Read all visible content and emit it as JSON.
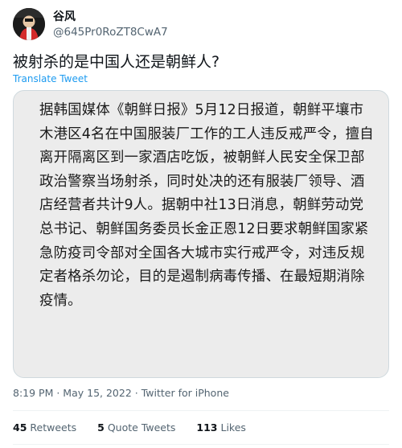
{
  "author": {
    "display_name": "谷风",
    "handle": "@645Pr0RoZT8CwA7"
  },
  "tweet": {
    "text": "被射杀的是中国人还是朝鲜人?",
    "translate_label": "Translate Tweet"
  },
  "media": {
    "text": "据韩国媒体《朝鲜日报》5月12日报道，朝鲜平壤市木港区4名在中国服装厂工作的工人违反戒严令，擅自离开隔离区到一家酒店吃饭，被朝鲜人民安全保卫部政治警察当场射杀，同时处决的还有服装厂领导、酒店经营者共计9人。据朝中社13日消息，朝鲜劳动党总书记、朝鲜国务委员长金正恩12日要求朝鲜国家紧急防疫司令部对全国各大城市实行戒严令，对违反规定者格杀勿论，目的是遏制病毒传播、在最短期消除疫情。"
  },
  "meta": {
    "time": "8:19 PM",
    "separator1": " · ",
    "date": "May 15, 2022",
    "separator2": " · ",
    "source": "Twitter for iPhone"
  },
  "stats": {
    "retweets_count": "45",
    "retweets_label": "Retweets",
    "quotes_count": "5",
    "quotes_label": "Quote Tweets",
    "likes_count": "113",
    "likes_label": "Likes"
  },
  "colors": {
    "text_primary": "#0f1419",
    "text_secondary": "#536471",
    "link": "#1d9bf0",
    "border": "#cfd9de",
    "media_bg": "#ececec"
  }
}
